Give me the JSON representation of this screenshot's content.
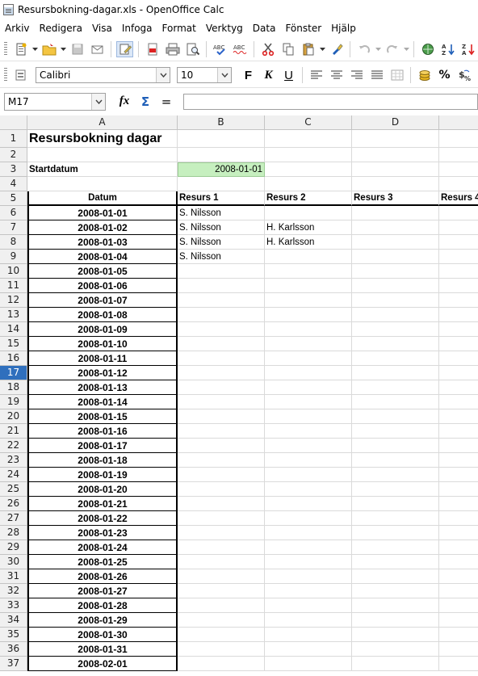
{
  "window": {
    "title": "Resursbokning-dagar.xls - OpenOffice Calc"
  },
  "menu": [
    "Arkiv",
    "Redigera",
    "Visa",
    "Infoga",
    "Format",
    "Verktyg",
    "Data",
    "Fönster",
    "Hjälp"
  ],
  "font_toolbar": {
    "font_name": "Calibri",
    "font_size": "10",
    "bold_label": "F",
    "italic_label": "K",
    "underline_label": "U"
  },
  "formula_bar": {
    "name_box": "M17",
    "input": ""
  },
  "columns": [
    "A",
    "B",
    "C",
    "D"
  ],
  "active_row": "17",
  "sheet": {
    "title": "Resursbokning dagar",
    "start_label": "Startdatum",
    "start_value": "2008-01-01",
    "headers": [
      "Datum",
      "Resurs 1",
      "Resurs 2",
      "Resurs 3",
      "Resurs 4"
    ],
    "rows": [
      {
        "n": "1"
      },
      {
        "n": "2"
      },
      {
        "n": "3"
      },
      {
        "n": "4"
      },
      {
        "n": "5"
      },
      {
        "n": "6",
        "date": "2008-01-01",
        "r1": "S. Nilsson",
        "r2": ""
      },
      {
        "n": "7",
        "date": "2008-01-02",
        "r1": "S. Nilsson",
        "r2": "H. Karlsson"
      },
      {
        "n": "8",
        "date": "2008-01-03",
        "r1": "S. Nilsson",
        "r2": "H. Karlsson"
      },
      {
        "n": "9",
        "date": "2008-01-04",
        "r1": "S. Nilsson",
        "r2": ""
      },
      {
        "n": "10",
        "date": "2008-01-05"
      },
      {
        "n": "11",
        "date": "2008-01-06"
      },
      {
        "n": "12",
        "date": "2008-01-07"
      },
      {
        "n": "13",
        "date": "2008-01-08"
      },
      {
        "n": "14",
        "date": "2008-01-09"
      },
      {
        "n": "15",
        "date": "2008-01-10"
      },
      {
        "n": "16",
        "date": "2008-01-11"
      },
      {
        "n": "17",
        "date": "2008-01-12"
      },
      {
        "n": "18",
        "date": "2008-01-13"
      },
      {
        "n": "19",
        "date": "2008-01-14"
      },
      {
        "n": "20",
        "date": "2008-01-15"
      },
      {
        "n": "21",
        "date": "2008-01-16"
      },
      {
        "n": "22",
        "date": "2008-01-17"
      },
      {
        "n": "23",
        "date": "2008-01-18"
      },
      {
        "n": "24",
        "date": "2008-01-19"
      },
      {
        "n": "25",
        "date": "2008-01-20"
      },
      {
        "n": "26",
        "date": "2008-01-21"
      },
      {
        "n": "27",
        "date": "2008-01-22"
      },
      {
        "n": "28",
        "date": "2008-01-23"
      },
      {
        "n": "29",
        "date": "2008-01-24"
      },
      {
        "n": "30",
        "date": "2008-01-25"
      },
      {
        "n": "31",
        "date": "2008-01-26"
      },
      {
        "n": "32",
        "date": "2008-01-27"
      },
      {
        "n": "33",
        "date": "2008-01-28"
      },
      {
        "n": "34",
        "date": "2008-01-29"
      },
      {
        "n": "35",
        "date": "2008-01-30"
      },
      {
        "n": "36",
        "date": "2008-01-31"
      },
      {
        "n": "37",
        "date": "2008-02-01"
      }
    ]
  },
  "colors": {
    "active_row_header": "#2f6fbd",
    "highlight_cell": "#c6efbf"
  }
}
